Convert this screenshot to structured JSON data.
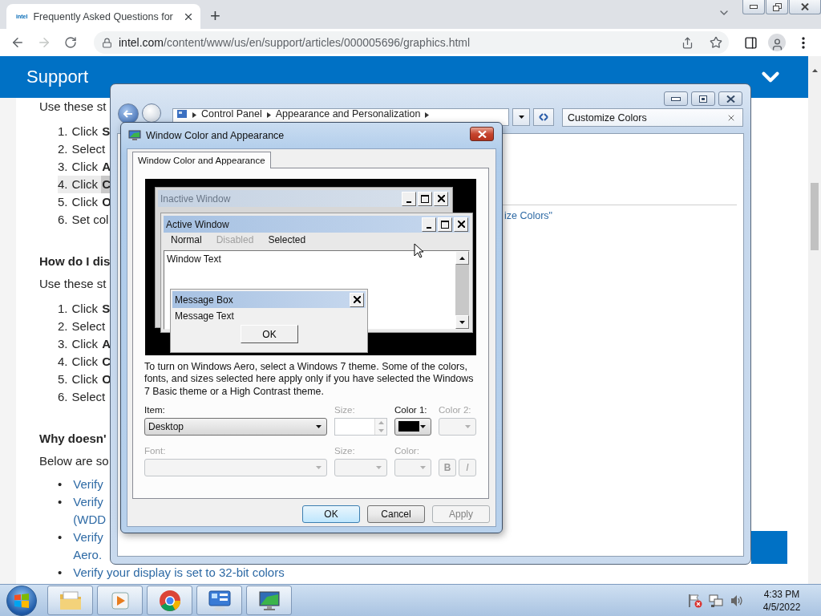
{
  "browser": {
    "tabs": [
      {
        "favicon": "intel",
        "title": "Frequently Asked Questions for",
        "selected": true
      }
    ],
    "new_tab": "+",
    "forward_disabled": true,
    "url_host": "intel.com",
    "url_path": "/content/www/us/en/support/articles/000005696/graphics.html"
  },
  "page": {
    "header": "Support",
    "blocks": [
      {
        "kind": "para",
        "text": "Use these st"
      },
      {
        "kind": "ol",
        "items": [
          {
            "number": "1.",
            "text": "Click **S**",
            "highlighted": false
          },
          {
            "number": "2.",
            "text": "Select",
            "highlighted": false
          },
          {
            "number": "3.",
            "text": "Click **A**",
            "highlighted": false
          },
          {
            "number": "4.",
            "text": "Click **C**",
            "highlighted": true
          },
          {
            "number": "5.",
            "text": "Click **O**",
            "highlighted": false
          },
          {
            "number": "6.",
            "text": "Set col",
            "highlighted": false
          }
        ]
      },
      {
        "kind": "heading",
        "text": "How do I dis"
      },
      {
        "kind": "para",
        "text": "Use these st"
      },
      {
        "kind": "ol",
        "items": [
          {
            "number": "1.",
            "text": "Click **S**",
            "highlighted": false
          },
          {
            "number": "2.",
            "text": "Select",
            "highlighted": false
          },
          {
            "number": "3.",
            "text": "Click **A**",
            "highlighted": false
          },
          {
            "number": "4.",
            "text": "Click **C**",
            "highlighted": false
          },
          {
            "number": "5.",
            "text": "Click **O**",
            "highlighted": false
          },
          {
            "number": "6.",
            "text": "Select",
            "highlighted": false
          }
        ]
      },
      {
        "kind": "heading",
        "text": "Why doesn'"
      },
      {
        "kind": "para",
        "text": "Below are so"
      },
      {
        "kind": "ul",
        "bullet": "•",
        "items": [
          {
            "lines": [
              "Verify"
            ]
          },
          {
            "lines": [
              "Verify",
              "(WDD"
            ]
          },
          {
            "lines": [
              "Verify",
              "Aero."
            ]
          },
          {
            "lines": [
              "Verify your display is set to 32-bit colors"
            ]
          }
        ]
      }
    ]
  },
  "control_panel": {
    "breadcrumb": [
      "Control Panel",
      "Appearance and Personalization"
    ],
    "search": {
      "value": "Customize Colors"
    },
    "link": "ize Colors\""
  },
  "dialog": {
    "title": "Window Color and Appearance",
    "tabs": [
      {
        "label": "Window Color and Appearance",
        "selected": true
      }
    ],
    "preview": {
      "inactive_title": "Inactive Window",
      "active_title": "Active Window",
      "menu": [
        {
          "label": "Normal",
          "disabled": false
        },
        {
          "label": "Disabled",
          "disabled": true
        },
        {
          "label": "Selected",
          "disabled": false
        }
      ],
      "window_text": "Window Text",
      "message_title": "Message Box",
      "message_text": "Message Text",
      "message_button": "OK"
    },
    "description": "To turn on Windows Aero, select a Windows 7 theme.  Some of the colors, fonts, and sizes selected here apply only if you have selected the Windows 7 Basic theme or a High Contrast theme.",
    "fields": [
      {
        "label": "Item:",
        "kind": "select",
        "value": "Desktop",
        "disabled": false
      },
      {
        "label": "Size:",
        "kind": "spinner",
        "disabled": true
      },
      {
        "label": "Color 1:",
        "kind": "color",
        "color": "#000000",
        "disabled": false
      },
      {
        "label": "Color 2:",
        "kind": "color",
        "disabled": true
      },
      {
        "label": "Font:",
        "kind": "select",
        "disabled": true
      },
      {
        "label": "Size:",
        "kind": "select",
        "disabled": true
      },
      {
        "label": "Color:",
        "kind": "color",
        "disabled": true
      },
      {
        "kind": "toggles",
        "buttons": [
          {
            "label": "B",
            "kind": "bold",
            "disabled": true
          },
          {
            "label": "I",
            "kind": "italic",
            "disabled": true
          }
        ]
      }
    ],
    "buttons": [
      {
        "label": "OK",
        "default": true,
        "disabled": false
      },
      {
        "label": "Cancel",
        "default": false,
        "disabled": false
      },
      {
        "label": "Apply",
        "default": false,
        "disabled": true
      }
    ]
  },
  "taskbar": {
    "apps": [
      {
        "kind": "explorer"
      },
      {
        "kind": "media"
      },
      {
        "kind": "browser"
      },
      {
        "kind": "control-panel"
      },
      {
        "kind": "display"
      }
    ],
    "tray": [
      {
        "kind": "flag"
      },
      {
        "kind": "network"
      },
      {
        "kind": "volume"
      }
    ],
    "time": "4:33 PM",
    "date": "4/5/2022"
  }
}
